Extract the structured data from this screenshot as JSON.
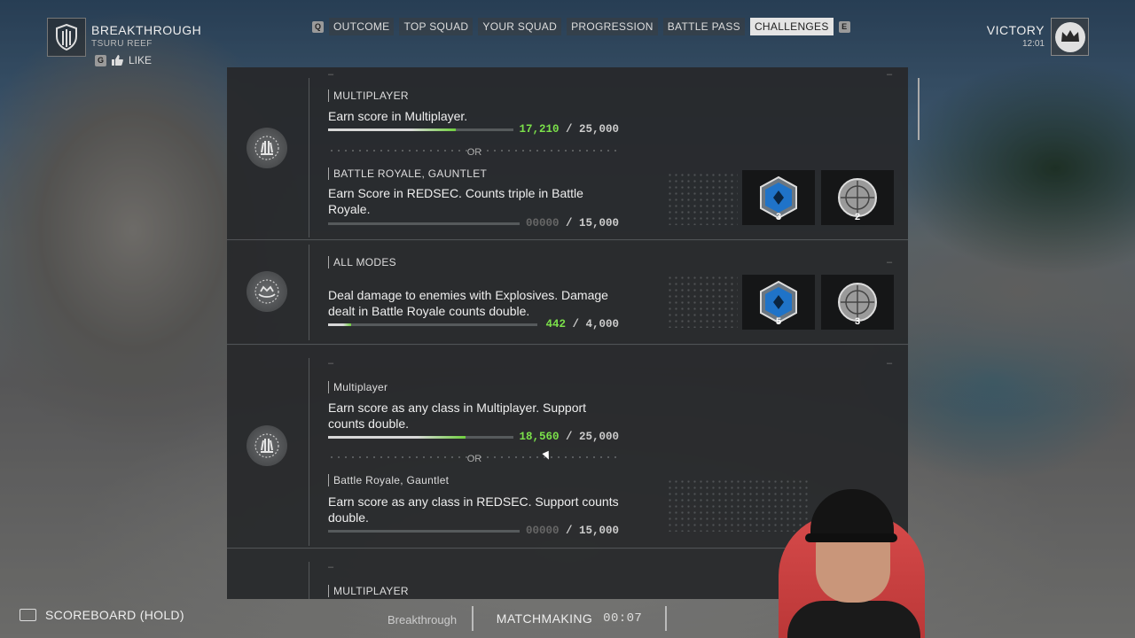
{
  "header": {
    "map_title": "BREAKTHROUGH",
    "map_subtitle": "TSURU REEF",
    "like_key": "G",
    "like_label": "LIKE",
    "tab_prev_key": "Q",
    "tab_next_key": "E",
    "tabs": [
      {
        "label": "OUTCOME",
        "active": false
      },
      {
        "label": "TOP SQUAD",
        "active": false
      },
      {
        "label": "YOUR SQUAD",
        "active": false
      },
      {
        "label": "PROGRESSION",
        "active": false
      },
      {
        "label": "BATTLE PASS",
        "active": false
      },
      {
        "label": "CHALLENGES",
        "active": true
      }
    ],
    "result_title": "VICTORY",
    "result_time": "12:01"
  },
  "challenges": [
    {
      "icon": "crossed-hands-emblem-icon",
      "options": [
        {
          "mode": "MULTIPLAYER",
          "desc": "Earn score in Multiplayer.",
          "current": "17,210",
          "target": "/ 25,000",
          "progress": 0.69
        },
        {
          "mode": "BATTLE ROYALE, GAUNTLET",
          "desc": "Earn Score in REDSEC. Counts triple in Battle Royale.",
          "current": "00000",
          "target": "/ 15,000",
          "progress": 0
        }
      ],
      "or_label": "OR",
      "rewards": [
        {
          "icon": "blue-xp-token-icon",
          "count": "3"
        },
        {
          "icon": "gray-crosshair-token-icon",
          "count": "2"
        }
      ]
    },
    {
      "icon": "explosion-emblem-icon",
      "options": [
        {
          "mode": "ALL MODES",
          "desc": "Deal damage to enemies with Explosives. Damage dealt in Battle Royale counts double.",
          "current": "442",
          "target": "/ 4,000",
          "progress": 0.11
        }
      ],
      "rewards": [
        {
          "icon": "blue-xp-token-icon",
          "count": "5"
        },
        {
          "icon": "gray-crosshair-token-icon",
          "count": "3"
        }
      ]
    },
    {
      "icon": "crossed-hands-emblem-icon",
      "options": [
        {
          "mode": "Multiplayer",
          "desc": "Earn score as any class in Multiplayer. Support counts double.",
          "current": "18,560",
          "target": "/ 25,000",
          "progress": 0.74
        },
        {
          "mode": "Battle Royale, Gauntlet",
          "desc": "Earn score as any class in REDSEC. Support counts double.",
          "current": "00000",
          "target": "/ 15,000",
          "progress": 0
        }
      ],
      "or_label": "OR"
    },
    {
      "options": [
        {
          "mode": "MULTIPLAYER"
        }
      ]
    }
  ],
  "footer": {
    "scoreboard_label": "SCOREBOARD (HOLD)",
    "mode_label": "Breakthrough",
    "matchmaking_label": "MATCHMAKING",
    "matchmaking_time": "00:07"
  },
  "colors": {
    "progress_green": "#7be04a",
    "accent_tab": "#e4e4e4"
  }
}
